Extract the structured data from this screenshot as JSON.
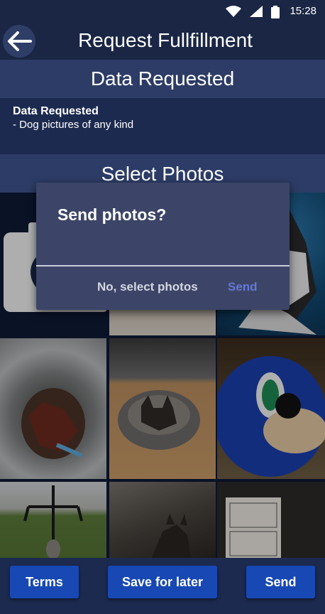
{
  "status_bar": {
    "time": "15:28"
  },
  "app_bar": {
    "title": "Request Fullfillment"
  },
  "data_section": {
    "header": "Data Requested",
    "label": "Data Requested",
    "item": "- Dog pictures of any kind"
  },
  "photos_section": {
    "header": "Select Photos"
  },
  "photos": [
    {
      "name": "camera-tile"
    },
    {
      "name": "photo-carpet"
    },
    {
      "name": "photo-husky"
    },
    {
      "name": "photo-lobster-pot"
    },
    {
      "name": "photo-dog-in-bed"
    },
    {
      "name": "photo-sonic-plush"
    },
    {
      "name": "photo-backyard"
    },
    {
      "name": "photo-brindle-dog"
    },
    {
      "name": "photo-sketch-paper"
    }
  ],
  "dialog": {
    "title": "Send photos?",
    "negative_label": "No, select photos",
    "positive_label": "Send"
  },
  "bottom_bar": {
    "terms_label": "Terms",
    "save_label": "Save for later",
    "send_label": "Send"
  },
  "colors": {
    "background": "#1c2a4f",
    "section_header": "#2c3c66",
    "dialog_bg": "#3c4567",
    "dialog_positive": "#6478d4",
    "button_blue": "#1748b4"
  }
}
